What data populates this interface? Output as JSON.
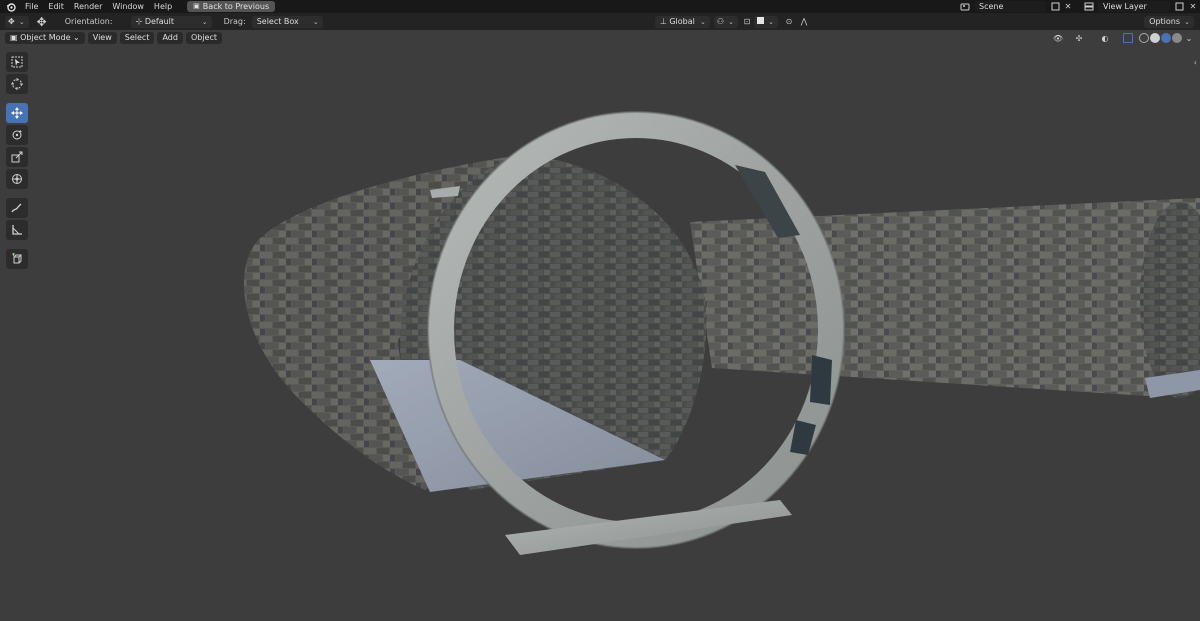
{
  "colors": {
    "accent": "#4772b3",
    "background": "#3d3d3d",
    "topbar": "#181818",
    "header": "#232323"
  },
  "topbar": {
    "menu": [
      "File",
      "Edit",
      "Render",
      "Window",
      "Help"
    ],
    "back_button": "Back to Previous",
    "scene_field": "Scene",
    "view_layer_field": "View Layer"
  },
  "tool_header": {
    "orientation_label": "Orientation:",
    "orientation_value": "Default",
    "drag_label": "Drag:",
    "drag_value": "Select Box",
    "transform_orientation": "Global",
    "options_label": "Options"
  },
  "viewport_header": {
    "mode": "Object Mode",
    "menu": [
      "View",
      "Select",
      "Add",
      "Object"
    ]
  },
  "toolbar": {
    "tools": [
      {
        "name": "select-box-tool",
        "icon": "select-box-icon",
        "active": false
      },
      {
        "name": "cursor-tool",
        "icon": "cursor-icon",
        "active": false
      },
      {
        "name": "move-tool",
        "icon": "move-icon",
        "active": true
      },
      {
        "name": "rotate-tool",
        "icon": "rotate-icon",
        "active": false
      },
      {
        "name": "scale-tool",
        "icon": "scale-icon",
        "active": false
      },
      {
        "name": "transform-tool",
        "icon": "transform-icon",
        "active": false
      },
      {
        "name": "annotate-tool",
        "icon": "annotate-icon",
        "active": false
      },
      {
        "name": "measure-tool",
        "icon": "measure-icon",
        "active": false
      },
      {
        "name": "add-cube-tool",
        "icon": "add-cube-icon",
        "active": false
      }
    ]
  }
}
